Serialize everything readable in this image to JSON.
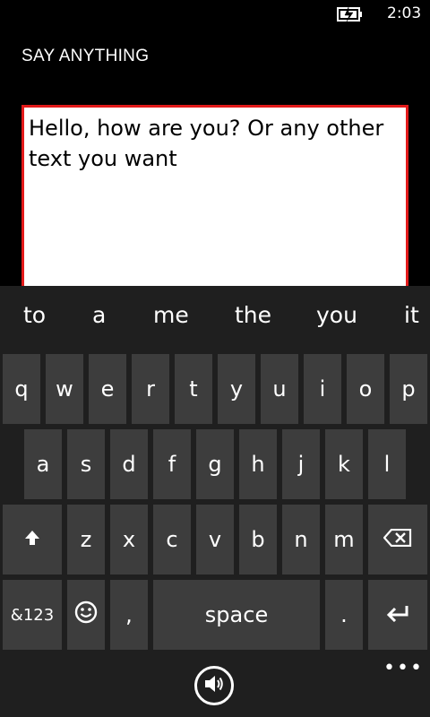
{
  "status": {
    "time": "2:03",
    "battery_icon": "battery-charging-icon"
  },
  "app": {
    "title": "SAY ANYTHING"
  },
  "textbox": {
    "value": "Hello, how are you? Or any other text you want"
  },
  "keyboard": {
    "suggestions": [
      "to",
      "a",
      "me",
      "the",
      "you",
      "it"
    ],
    "row1": [
      "q",
      "w",
      "e",
      "r",
      "t",
      "y",
      "u",
      "i",
      "o",
      "p"
    ],
    "row2": [
      "a",
      "s",
      "d",
      "f",
      "g",
      "h",
      "j",
      "k",
      "l"
    ],
    "row3": [
      "z",
      "x",
      "c",
      "v",
      "b",
      "n",
      "m"
    ],
    "symbols_label": "&123",
    "comma_label": ",",
    "space_label": "space",
    "period_label": ".",
    "more_label": "•••",
    "colors": {
      "background": "#1f1f1f",
      "key": "#3d3d3d",
      "accent_border": "#e31a1a"
    }
  }
}
